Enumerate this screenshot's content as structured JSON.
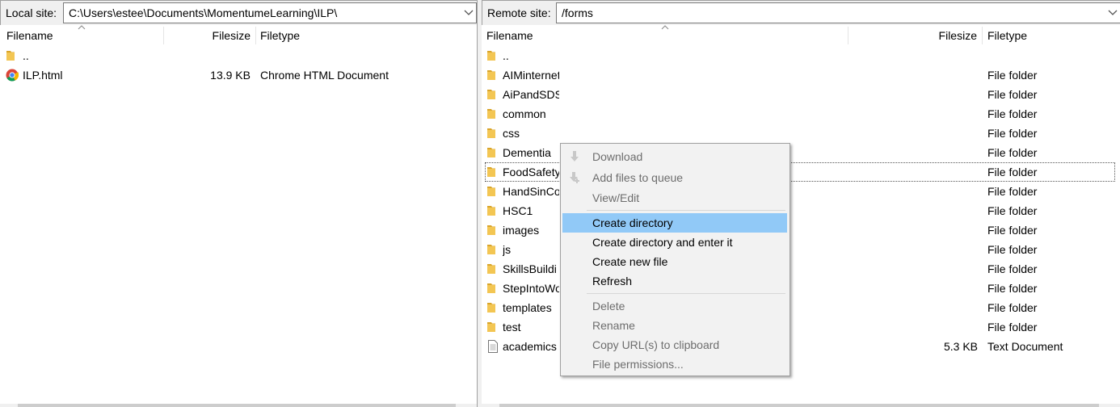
{
  "local": {
    "label": "Local site:",
    "path": "C:\\Users\\estee\\Documents\\MomentumeLearning\\ILP\\",
    "columns": {
      "filename": "Filename",
      "filesize": "Filesize",
      "filetype": "Filetype"
    },
    "rows": [
      {
        "name": "..",
        "size": "",
        "type": "",
        "icon": "folder-icon"
      },
      {
        "name": "ILP.html",
        "size": "13.9 KB",
        "type": "Chrome HTML Document",
        "icon": "chrome-icon"
      }
    ]
  },
  "remote": {
    "label": "Remote site:",
    "path": "/forms",
    "columns": {
      "filename": "Filename",
      "filesize": "Filesize",
      "filetype": "Filetype"
    },
    "rows": [
      {
        "name": "..",
        "size": "",
        "type": "",
        "icon": "folder-icon"
      },
      {
        "name": "AIMinternetsecurity",
        "size": "",
        "type": "File folder",
        "icon": "folder-icon"
      },
      {
        "name": "AiPandSDS",
        "size": "",
        "type": "File folder",
        "icon": "folder-icon"
      },
      {
        "name": "common",
        "size": "",
        "type": "File folder",
        "icon": "folder-icon"
      },
      {
        "name": "css",
        "size": "",
        "type": "File folder",
        "icon": "folder-icon"
      },
      {
        "name": "Dementia",
        "size": "",
        "type": "File folder",
        "icon": "folder-icon"
      },
      {
        "name": "FoodSafety",
        "size": "",
        "type": "File folder",
        "icon": "folder-icon"
      },
      {
        "name": "HandSinCo",
        "size": "",
        "type": "File folder",
        "icon": "folder-icon"
      },
      {
        "name": "HSC1",
        "size": "",
        "type": "File folder",
        "icon": "folder-icon"
      },
      {
        "name": "images",
        "size": "",
        "type": "File folder",
        "icon": "folder-icon"
      },
      {
        "name": "js",
        "size": "",
        "type": "File folder",
        "icon": "folder-icon"
      },
      {
        "name": "SkillsBuildi",
        "size": "",
        "type": "File folder",
        "icon": "folder-icon"
      },
      {
        "name": "StepIntoWo",
        "size": "",
        "type": "File folder",
        "icon": "folder-icon"
      },
      {
        "name": "templates",
        "size": "",
        "type": "File folder",
        "icon": "folder-icon"
      },
      {
        "name": "test",
        "size": "",
        "type": "File folder",
        "icon": "folder-icon"
      },
      {
        "name": "academics",
        "size": "5.3 KB",
        "type": "Text Document",
        "icon": "text-file-icon"
      }
    ]
  },
  "context_menu": {
    "download": "Download",
    "add_to_queue": "Add files to queue",
    "view_edit": "View/Edit",
    "create_directory": "Create directory",
    "create_directory_enter": "Create directory and enter it",
    "create_new_file": "Create new file",
    "refresh": "Refresh",
    "delete": "Delete",
    "rename": "Rename",
    "copy_url": "Copy URL(s) to clipboard",
    "file_permissions": "File permissions..."
  },
  "colors": {
    "menu_highlight": "#91c9f7",
    "folder": "#e8b63a",
    "disabled_text": "#6d6d6d"
  }
}
